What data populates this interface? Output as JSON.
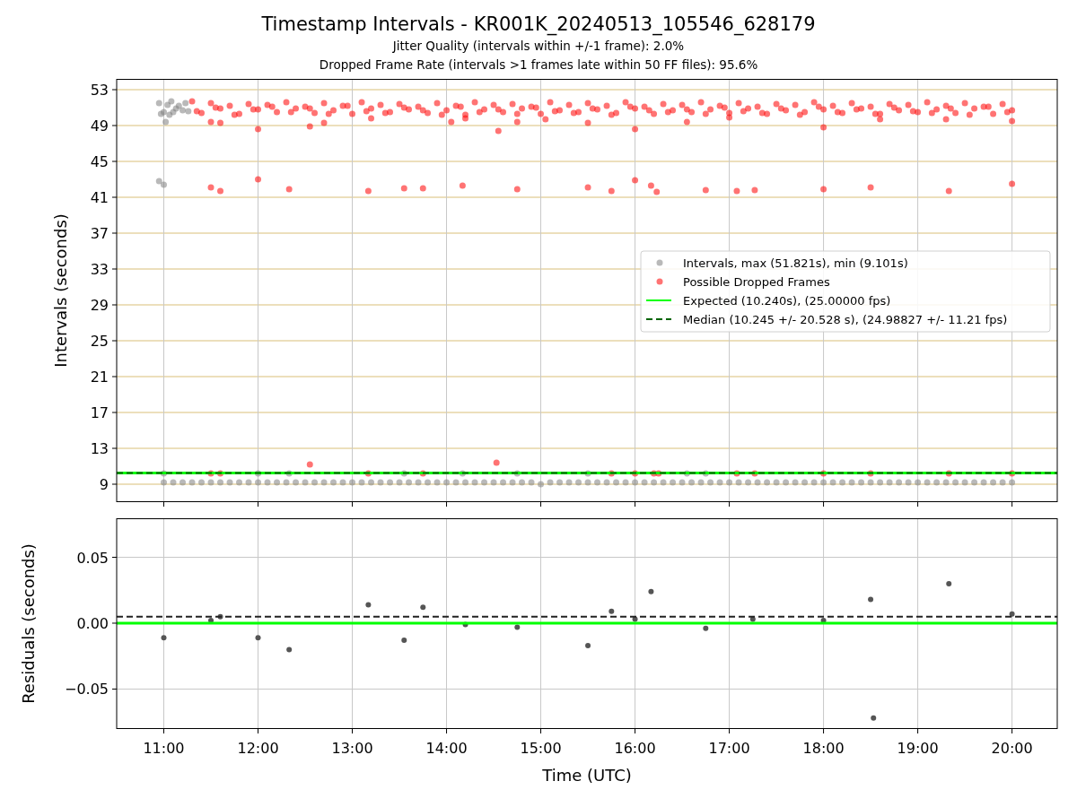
{
  "figure": {
    "title": "Timestamp Intervals - KR001K_20240513_105546_628179",
    "subtitles": [
      "Jitter Quality (intervals within +/-1 frame): 2.0%",
      "Dropped Frame Rate (intervals >1 frames late within 50 FF files): 95.6%"
    ]
  },
  "charts": [
    {
      "chart_data": {
        "type": "scatter",
        "ylabel": "Intervals (seconds)",
        "xlim": [
          10.5,
          20.48
        ],
        "ylim": [
          7.0,
          54.2
        ],
        "grid": true,
        "legend": "center right",
        "yticks": [
          {
            "value": 9,
            "label": "9"
          },
          {
            "value": 13,
            "label": "13"
          },
          {
            "value": 17,
            "label": "17"
          },
          {
            "value": 21,
            "label": "21"
          },
          {
            "value": 25,
            "label": "25"
          },
          {
            "value": 29,
            "label": "29"
          },
          {
            "value": 33,
            "label": "33"
          },
          {
            "value": 37,
            "label": "37"
          },
          {
            "value": 41,
            "label": "41"
          },
          {
            "value": 45,
            "label": "45"
          },
          {
            "value": 49,
            "label": "49"
          },
          {
            "value": 53,
            "label": "53"
          }
        ],
        "series": [
          {
            "name": "Intervals, max (51.821s), min (9.101s)",
            "color": "#808080",
            "x": [
              10.95,
              10.97,
              11.0,
              11.02,
              11.04,
              11.06,
              11.08,
              11.1,
              11.13,
              11.16,
              11.2,
              11.23,
              11.26,
              10.95,
              11.0,
              11.0,
              12.0,
              12.33,
              13.55,
              14.17,
              14.75,
              15.5,
              16.55,
              16.75,
              11.0,
              11.1,
              11.2,
              11.3,
              11.4,
              11.5,
              11.6,
              11.7,
              11.8,
              11.9,
              12.0,
              12.1,
              12.2,
              12.3,
              12.4,
              12.5,
              12.6,
              12.7,
              12.8,
              12.9,
              13.0,
              13.1,
              13.2,
              13.3,
              13.4,
              13.5,
              13.6,
              13.7,
              13.8,
              13.9,
              14.0,
              14.1,
              14.2,
              14.3,
              14.4,
              14.5,
              14.6,
              14.7,
              14.8,
              14.9,
              15.0,
              15.1,
              15.2,
              15.3,
              15.4,
              15.5,
              15.6,
              15.7,
              15.8,
              15.9,
              16.0,
              16.1,
              16.2,
              16.3,
              16.4,
              16.5,
              16.6,
              16.7,
              16.8,
              16.9,
              17.0,
              17.1,
              17.2,
              17.3,
              17.4,
              17.5,
              17.6,
              17.7,
              17.8,
              17.9,
              18.0,
              18.1,
              18.2,
              18.3,
              18.4,
              18.5,
              18.6,
              18.7,
              18.8,
              18.9,
              19.0,
              19.1,
              19.2,
              19.3,
              19.4,
              19.5,
              19.6,
              19.7,
              19.8,
              19.9,
              20.0
            ],
            "values": [
              51.5,
              50.3,
              50.5,
              49.4,
              51.3,
              50.2,
              51.7,
              50.5,
              50.9,
              51.2,
              50.7,
              51.5,
              50.6,
              42.8,
              42.4,
              10.2,
              10.2,
              10.2,
              10.2,
              10.2,
              10.2,
              10.2,
              10.2,
              10.2,
              9.2,
              9.2,
              9.2,
              9.2,
              9.2,
              9.2,
              9.2,
              9.2,
              9.2,
              9.2,
              9.2,
              9.2,
              9.2,
              9.2,
              9.2,
              9.2,
              9.2,
              9.2,
              9.2,
              9.2,
              9.2,
              9.2,
              9.2,
              9.2,
              9.2,
              9.2,
              9.2,
              9.2,
              9.2,
              9.2,
              9.2,
              9.2,
              9.2,
              9.2,
              9.2,
              9.2,
              9.2,
              9.2,
              9.2,
              9.2,
              9.0,
              9.2,
              9.2,
              9.2,
              9.2,
              9.2,
              9.2,
              9.2,
              9.2,
              9.2,
              9.2,
              9.2,
              9.2,
              9.2,
              9.2,
              9.2,
              9.2,
              9.2,
              9.2,
              9.2,
              9.2,
              9.2,
              9.2,
              9.2,
              9.2,
              9.2,
              9.2,
              9.2,
              9.2,
              9.2,
              9.2,
              9.2,
              9.2,
              9.2,
              9.2,
              9.2,
              9.2,
              9.2,
              9.2,
              9.2,
              9.2,
              9.2,
              9.2,
              9.2,
              9.2,
              9.2,
              9.2,
              9.2,
              9.2,
              9.2,
              9.2
            ]
          },
          {
            "name": "Possible Dropped Frames",
            "color": "#ff0000",
            "x": [
              11.3,
              11.4,
              11.5,
              11.6,
              11.7,
              11.8,
              11.9,
              12.0,
              12.1,
              12.2,
              12.3,
              12.4,
              12.5,
              12.6,
              12.7,
              12.8,
              12.9,
              13.0,
              13.1,
              13.2,
              13.3,
              13.4,
              13.5,
              13.6,
              13.7,
              13.8,
              13.9,
              14.0,
              14.1,
              14.2,
              14.3,
              14.4,
              14.5,
              14.6,
              14.7,
              14.8,
              14.9,
              15.0,
              15.1,
              15.2,
              15.3,
              15.4,
              15.5,
              15.6,
              15.7,
              15.8,
              15.9,
              16.0,
              16.1,
              16.2,
              16.3,
              16.4,
              16.5,
              16.6,
              16.7,
              16.8,
              16.9,
              17.0,
              17.1,
              17.2,
              17.3,
              17.4,
              17.5,
              17.6,
              17.7,
              17.8,
              17.9,
              18.0,
              18.1,
              18.2,
              18.3,
              18.4,
              18.5,
              18.6,
              18.7,
              18.8,
              18.9,
              19.0,
              19.1,
              19.2,
              19.3,
              19.4,
              19.5,
              19.6,
              19.7,
              19.8,
              19.9,
              20.0,
              11.35,
              11.55,
              11.75,
              11.95,
              12.15,
              12.35,
              12.55,
              12.75,
              12.95,
              13.15,
              13.35,
              13.55,
              13.75,
              13.95,
              14.15,
              14.35,
              14.55,
              14.75,
              14.95,
              15.15,
              15.35,
              15.55,
              15.75,
              15.95,
              16.15,
              16.35,
              16.55,
              16.75,
              16.95,
              17.15,
              17.35,
              17.55,
              17.75,
              17.95,
              18.15,
              18.35,
              18.55,
              18.75,
              18.95,
              19.15,
              19.35,
              19.55,
              19.75,
              19.95,
              11.5,
              11.6,
              12.0,
              12.55,
              12.7,
              13.2,
              14.05,
              14.2,
              14.55,
              14.75,
              15.05,
              15.5,
              16.0,
              16.55,
              17.0,
              18.0,
              18.6,
              19.3,
              20.0,
              11.5,
              11.6,
              12.0,
              12.33,
              13.17,
              13.55,
              13.75,
              14.17,
              14.75,
              15.5,
              15.75,
              16.0,
              16.17,
              16.23,
              16.75,
              17.08,
              17.27,
              18.0,
              18.5,
              19.33,
              20.0,
              11.5,
              11.6,
              12.55,
              13.17,
              13.75,
              14.53,
              15.75,
              16.0,
              16.2,
              16.25,
              17.08,
              17.27,
              18.0,
              18.5,
              19.33,
              20.0
            ],
            "values": [
              51.7,
              50.4,
              51.5,
              50.9,
              51.2,
              50.3,
              51.4,
              50.8,
              51.3,
              50.5,
              51.6,
              50.9,
              51.1,
              50.4,
              51.5,
              50.7,
              51.2,
              50.3,
              51.6,
              50.9,
              51.3,
              50.5,
              51.4,
              50.8,
              51.1,
              50.4,
              51.5,
              50.7,
              51.2,
              50.2,
              51.6,
              50.8,
              51.3,
              50.5,
              51.4,
              50.9,
              51.1,
              50.3,
              51.6,
              50.7,
              51.3,
              50.5,
              51.5,
              50.8,
              51.2,
              50.4,
              51.6,
              50.9,
              51.1,
              50.3,
              51.4,
              50.7,
              51.3,
              50.5,
              51.6,
              50.8,
              51.2,
              50.4,
              51.5,
              50.9,
              51.1,
              50.3,
              51.4,
              50.7,
              51.3,
              50.5,
              51.6,
              50.8,
              51.2,
              50.4,
              51.5,
              50.9,
              51.1,
              50.3,
              51.4,
              50.7,
              51.3,
              50.5,
              51.6,
              50.8,
              51.2,
              50.4,
              51.5,
              50.9,
              51.1,
              50.3,
              51.4,
              50.7,
              50.6,
              51.0,
              50.2,
              50.8,
              51.1,
              50.5,
              50.9,
              50.3,
              51.2,
              50.6,
              50.4,
              51.0,
              50.7,
              50.2,
              51.1,
              50.5,
              50.8,
              50.3,
              51.0,
              50.6,
              50.4,
              50.9,
              50.2,
              51.1,
              50.7,
              50.5,
              50.8,
              50.3,
              51.0,
              50.6,
              50.4,
              50.9,
              50.2,
              51.1,
              50.5,
              50.8,
              50.3,
              51.0,
              50.6,
              50.4,
              50.9,
              50.2,
              51.1,
              50.5,
              49.4,
              49.3,
              48.6,
              48.9,
              49.3,
              49.8,
              49.4,
              49.8,
              48.4,
              49.4,
              49.7,
              49.3,
              48.6,
              49.4,
              49.9,
              48.8,
              49.7,
              49.7,
              49.5,
              42.1,
              41.7,
              43.0,
              41.9,
              41.7,
              42.0,
              42.0,
              42.3,
              41.9,
              42.1,
              41.7,
              42.9,
              42.3,
              41.6,
              41.8,
              41.7,
              41.8,
              41.9,
              42.1,
              41.7,
              42.5,
              10.2,
              10.2,
              11.2,
              10.2,
              10.2,
              11.4,
              10.2,
              10.2,
              10.2,
              10.2,
              10.2,
              10.2,
              10.2,
              10.2,
              10.2,
              10.2
            ]
          }
        ],
        "ref_lines": [
          {
            "axis": "y",
            "value": 10.24,
            "label": "Expected (10.240s), (25.00000 fps)",
            "color": "#00ff00"
          },
          {
            "axis": "y",
            "value": 10.245,
            "label": "Median (10.245 +/- 20.528 s), (24.98827 +/- 11.21 fps)",
            "color": "#006400"
          }
        ]
      }
    },
    {
      "chart_data": {
        "type": "scatter",
        "xlabel": "Time (UTC)",
        "ylabel": "Residuals (seconds)",
        "xlim": [
          10.5,
          20.48
        ],
        "ylim": [
          -0.0803,
          0.0796
        ],
        "grid": true,
        "xticks": [
          {
            "value": 11,
            "label": "11:00"
          },
          {
            "value": 12,
            "label": "12:00"
          },
          {
            "value": 13,
            "label": "13:00"
          },
          {
            "value": 14,
            "label": "14:00"
          },
          {
            "value": 15,
            "label": "15:00"
          },
          {
            "value": 16,
            "label": "16:00"
          },
          {
            "value": 17,
            "label": "17:00"
          },
          {
            "value": 18,
            "label": "18:00"
          },
          {
            "value": 19,
            "label": "19:00"
          },
          {
            "value": 20,
            "label": "20:00"
          }
        ],
        "yticks": [
          {
            "value": 0.05,
            "label": "0.05"
          },
          {
            "value": 0,
            "label": "0.00"
          },
          {
            "value": -0.05,
            "label": "−0.05"
          }
        ],
        "series": [
          {
            "color": "#555555",
            "x": [
              11.0,
              11.5,
              11.6,
              12.0,
              12.33,
              13.17,
              13.55,
              13.75,
              14.2,
              14.75,
              15.5,
              15.75,
              16.0,
              16.17,
              16.75,
              17.25,
              18.0,
              18.5,
              18.53,
              19.33,
              20.0
            ],
            "values": [
              -0.011,
              0.002,
              0.005,
              -0.011,
              -0.02,
              0.014,
              -0.013,
              0.012,
              -0.001,
              -0.003,
              -0.017,
              0.009,
              0.003,
              0.024,
              -0.004,
              0.003,
              0.002,
              0.018,
              -0.072,
              0.03,
              0.007
            ]
          }
        ],
        "ref_lines": [
          {
            "axis": "y",
            "value": 0,
            "color": "#00ff00"
          },
          {
            "axis": "y",
            "value": 0.005,
            "color": "#222222"
          }
        ]
      }
    }
  ]
}
